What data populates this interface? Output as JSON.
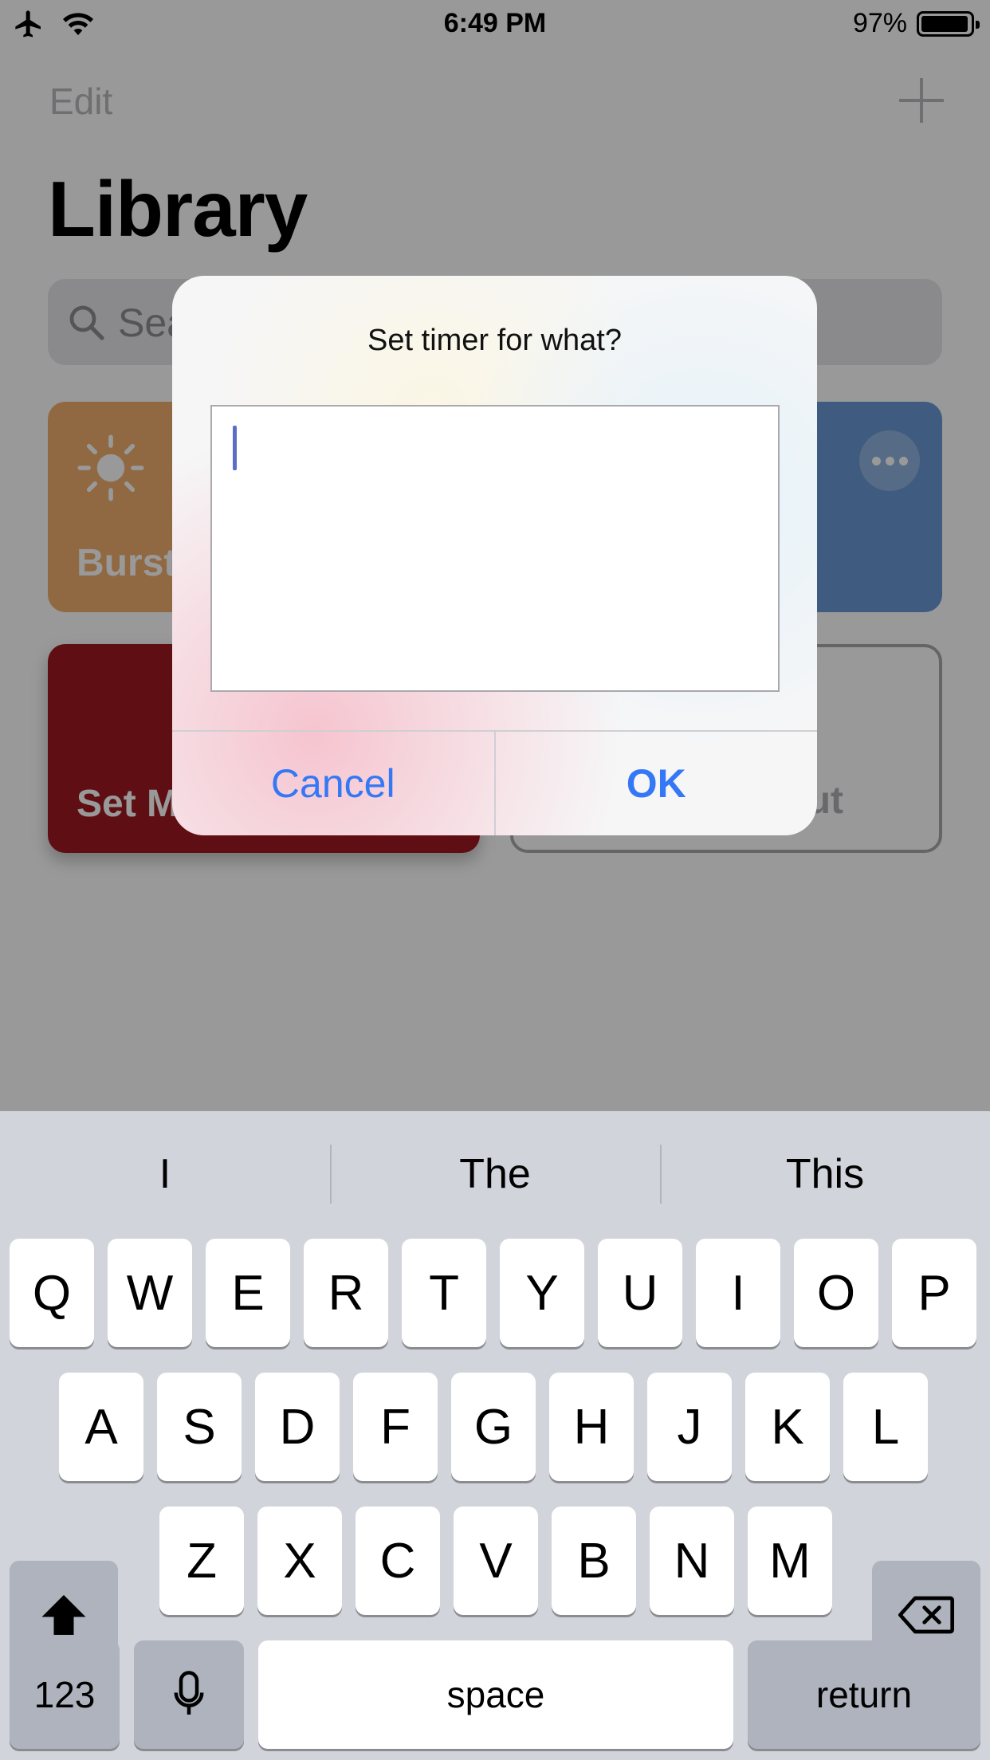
{
  "status_bar": {
    "time": "6:49 PM",
    "battery_percent": "97%",
    "battery_level": 0.97,
    "icons": [
      "airplane-icon",
      "wifi-icon",
      "battery-icon"
    ]
  },
  "app": {
    "nav_edit": "Edit",
    "title": "Library",
    "search_placeholder": "Sea",
    "tiles": [
      {
        "label": "Burst",
        "color": "#f0b070",
        "icon": "sun-icon"
      },
      {
        "label": "",
        "color": "#6a9ad6",
        "icon": "more-icon"
      },
      {
        "label": "Set M",
        "color": "#9e1a22"
      },
      {
        "label": "ut",
        "color": "#ffffff"
      }
    ]
  },
  "alert": {
    "title": "Set timer for what?",
    "input_value": "",
    "cancel_label": "Cancel",
    "ok_label": "OK",
    "accent": "#3478f6"
  },
  "keyboard": {
    "predictions": [
      "I",
      "The",
      "This"
    ],
    "row1": [
      "Q",
      "W",
      "E",
      "R",
      "T",
      "Y",
      "U",
      "I",
      "O",
      "P"
    ],
    "row2": [
      "A",
      "S",
      "D",
      "F",
      "G",
      "H",
      "J",
      "K",
      "L"
    ],
    "row3": [
      "Z",
      "X",
      "C",
      "V",
      "B",
      "N",
      "M"
    ],
    "numbers_label": "123",
    "space_label": "space",
    "return_label": "return"
  }
}
